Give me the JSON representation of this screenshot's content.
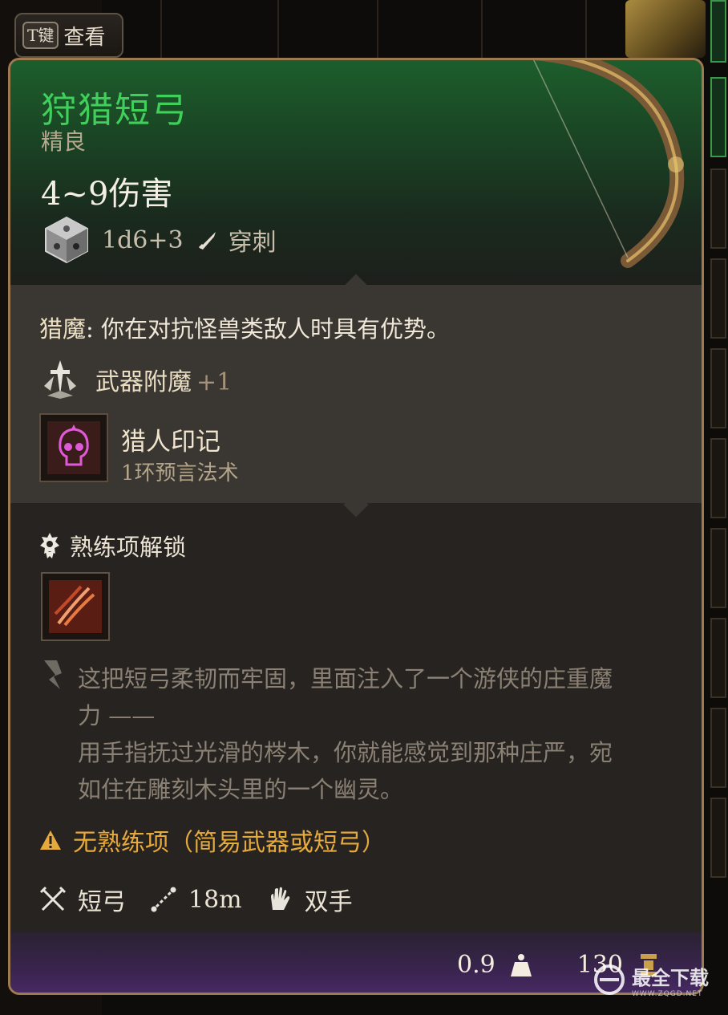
{
  "key_hint": {
    "key": "T键",
    "label": "查看"
  },
  "item": {
    "name": "狩猎短弓",
    "rarity": "精良",
    "damage": "4~9伤害",
    "dice": "1d6+3",
    "damage_type": "穿刺"
  },
  "enchantment": {
    "keyword": "猎魔",
    "description": ": 你在对抗怪兽类敌人时具有优势。",
    "weapon_enchant_label": "武器附魔",
    "weapon_enchant_value": "+1",
    "spell_name": "猎人印记",
    "spell_level": "1环预言法术"
  },
  "proficiency": {
    "heading": "熟练项解锁"
  },
  "lore": {
    "line1": "这把短弓柔韧而牢固，里面注入了一个游侠的庄重魔",
    "line2": "力 ——",
    "line3": "用手指抚过光滑的梣木，你就能感觉到那种庄严，宛",
    "line4": "如住在雕刻木头里的一个幽灵。"
  },
  "warning": "无熟练项（简易武器或短弓）",
  "stats": {
    "weapon_type": "短弓",
    "range": "18m",
    "handedness": "双手"
  },
  "footer": {
    "weight": "0.9",
    "value": "130"
  },
  "watermark": {
    "main": "最全下载",
    "sub": "WWW.ZQGD.NET"
  },
  "colors": {
    "rarity_green": "#3fcf5a",
    "warning_orange": "#e6a93b",
    "frame_gold": "#9d7a4f"
  }
}
